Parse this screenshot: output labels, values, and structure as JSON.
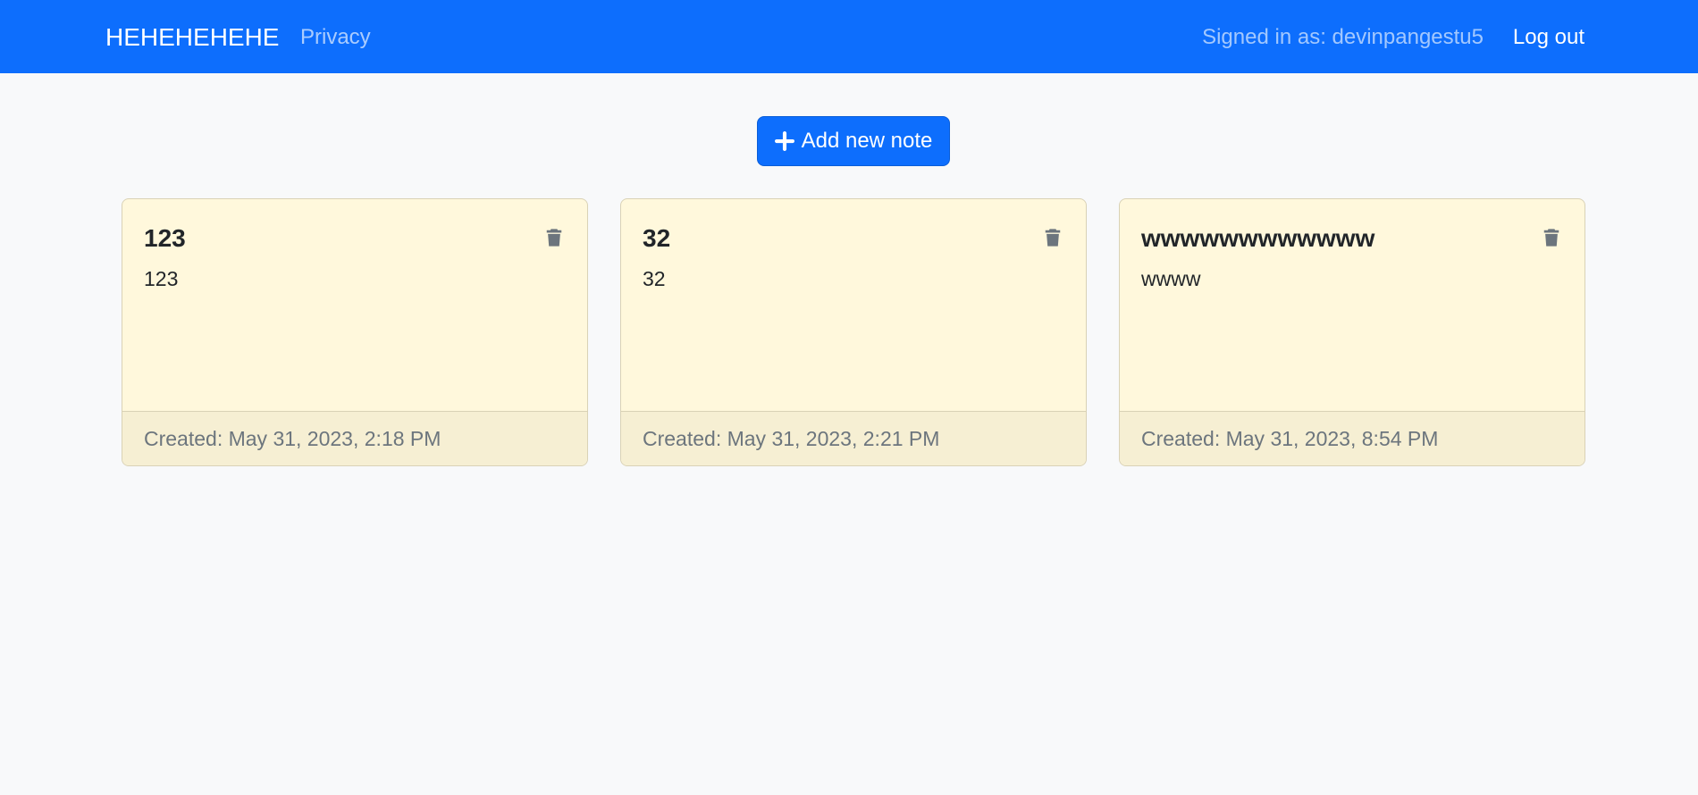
{
  "navbar": {
    "brand": "HEHEHEHEHE",
    "links": [
      {
        "label": "Privacy"
      }
    ],
    "signed_in_text": "Signed in as: devinpangestu5",
    "logout_label": "Log out",
    "background_color": "#0d6efd"
  },
  "main": {
    "add_button": {
      "icon": "plus-icon",
      "label": "Add new note"
    },
    "notes": [
      {
        "title": "123",
        "text": "123",
        "created": "Created: May 31, 2023, 2:18 PM",
        "icon": "trash-icon"
      },
      {
        "title": "32",
        "text": "32",
        "created": "Created: May 31, 2023, 2:21 PM",
        "icon": "trash-icon"
      },
      {
        "title": "wwwwwwwwwwww",
        "text": "wwww",
        "created": "Created: May 31, 2023, 8:54 PM",
        "icon": "trash-icon"
      }
    ]
  },
  "colors": {
    "accent": "#0d6efd",
    "card_bg": "#fff8dc",
    "page_bg": "#f8f9fa"
  }
}
